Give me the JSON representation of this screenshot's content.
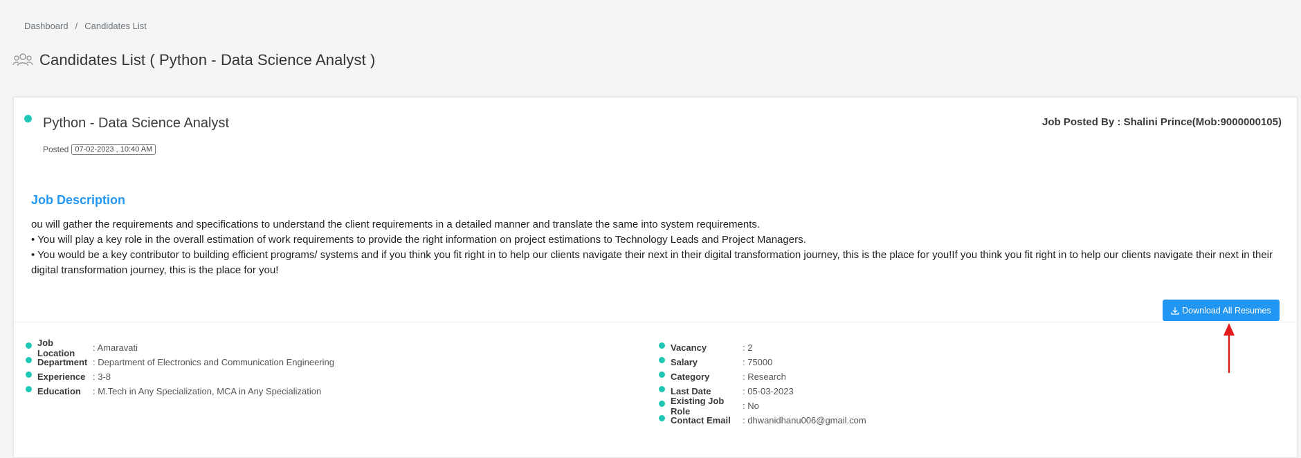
{
  "breadcrumb": {
    "items": [
      "Dashboard",
      "Candidates List"
    ],
    "separator": "/"
  },
  "header": {
    "icon": "users-icon",
    "title": "Candidates List ( Python - Data Science Analyst )"
  },
  "job": {
    "title": "Python - Data Science Analyst",
    "posted_label": "Posted",
    "posted_date": "07-02-2023 , 10:40 AM",
    "posted_by": "Job Posted By : Shalini Prince(Mob:9000000105)",
    "status_color": "#1fc7b6"
  },
  "description": {
    "heading": "Job Description",
    "lines": [
      "ou will gather the requirements and specifications to understand the client requirements in a detailed manner and translate the same into system requirements.",
      "• You will play a key role in the overall estimation of work requirements to provide the right information on project estimations to Technology Leads and Project Managers.",
      "• You would be a key contributor to building efficient programs/ systems and if you think you fit right in to help our clients navigate their next in their digital transformation journey, this is the place for you!If you think you fit right in to help our clients navigate their next in their digital transformation journey, this is the place for you!"
    ]
  },
  "actions": {
    "download_label": "Download All Resumes",
    "download_icon": "download-icon",
    "accent": "#2196f3"
  },
  "details_left": [
    {
      "label": "Job Location",
      "value": ": Amaravati"
    },
    {
      "label": "Department",
      "value": ": Department of Electronics and Communication Engineering"
    },
    {
      "label": "Experience",
      "value": ": 3-8"
    },
    {
      "label": "Education",
      "value": ": M.Tech in Any Specialization, MCA in Any Specialization"
    }
  ],
  "details_right": [
    {
      "label": "Vacancy",
      "value": ": 2"
    },
    {
      "label": "Salary",
      "value": ": 75000"
    },
    {
      "label": "Category",
      "value": ": Research"
    },
    {
      "label": "Last Date",
      "value": ": 05-03-2023"
    },
    {
      "label": "Existing Job Role",
      "value": ": No"
    },
    {
      "label": "Contact Email",
      "value": ": dhwanidhanu006@gmail.com"
    }
  ]
}
